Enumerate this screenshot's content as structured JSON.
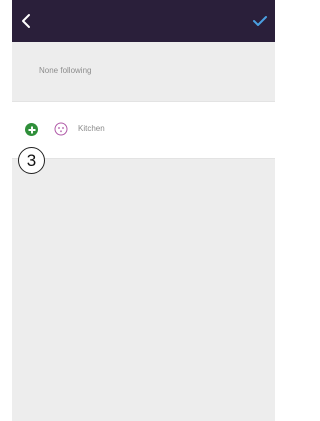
{
  "header": {
    "back_icon": "chevron-left-icon",
    "confirm_icon": "checkmark-icon",
    "accent_color": "#4a9fe0",
    "bar_color": "#2a1f3a"
  },
  "main": {
    "following_status": "None following",
    "rooms": [
      {
        "label": "Kitchen",
        "action_icon": "add-circle-icon",
        "room_icon": "outlet-icon"
      }
    ]
  },
  "annotation": {
    "callout_number": "3"
  }
}
